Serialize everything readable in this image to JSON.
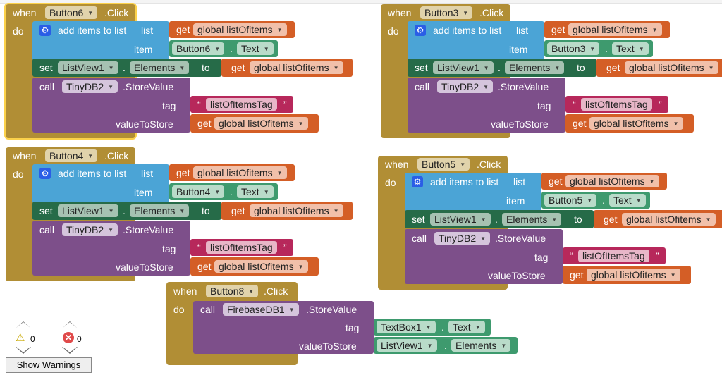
{
  "labels": {
    "when": "when",
    "do": "do",
    "click": ".Click",
    "add_items": "add items to list",
    "list": "list",
    "item": "item",
    "set": "set",
    "to": "to",
    "call": "call",
    "store_value": ".StoreValue",
    "tag": "tag",
    "value_to_store": "valueToStore",
    "get": "get",
    "dot": ".",
    "open_quote": "“",
    "close_quote": "”"
  },
  "values": {
    "global_var": "global listOfitems",
    "list_view": "ListView1",
    "elements": "Elements",
    "text_prop": "Text",
    "tinydb": "TinyDB2",
    "tag_string": "listOfItemsTag",
    "firebase": "FirebaseDB1",
    "textbox": "TextBox1"
  },
  "blocks": [
    {
      "button": "Button6",
      "selected": true
    },
    {
      "button": "Button3",
      "selected": false
    },
    {
      "button": "Button4",
      "selected": false
    },
    {
      "button": "Button5",
      "selected": false
    }
  ],
  "firebase_block": {
    "button": "Button8"
  },
  "warnings": {
    "warning_count": "0",
    "error_count": "0",
    "show_warnings_label": "Show Warnings"
  }
}
